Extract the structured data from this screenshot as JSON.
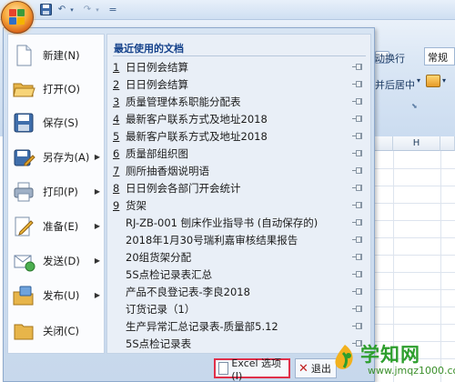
{
  "quick_access": {
    "separator": "="
  },
  "ribbon": {
    "wrap_text_label": "动换行",
    "merge_center_label": "并后居中",
    "number_format_value": "常规"
  },
  "sheet": {
    "column_h": "H"
  },
  "office_menu": {
    "commands": [
      {
        "label": "新建(N)",
        "icon": "new-document-icon",
        "submenu": false
      },
      {
        "label": "打开(O)",
        "icon": "open-folder-icon",
        "submenu": false
      },
      {
        "label": "保存(S)",
        "icon": "save-disk-icon",
        "submenu": false
      },
      {
        "label": "另存为(A)",
        "icon": "save-as-icon",
        "submenu": true
      },
      {
        "label": "打印(P)",
        "icon": "printer-icon",
        "submenu": true
      },
      {
        "label": "准备(E)",
        "icon": "prepare-icon",
        "submenu": true
      },
      {
        "label": "发送(D)",
        "icon": "send-mail-icon",
        "submenu": true
      },
      {
        "label": "发布(U)",
        "icon": "publish-icon",
        "submenu": true
      },
      {
        "label": "关闭(C)",
        "icon": "close-folder-icon",
        "submenu": false
      }
    ],
    "recent_header": "最近使用的文档",
    "recent_documents": [
      {
        "num": "1",
        "name": "日日例会结算"
      },
      {
        "num": "2",
        "name": "日日例会结算"
      },
      {
        "num": "3",
        "name": "质量管理体系职能分配表"
      },
      {
        "num": "4",
        "name": "最新客户联系方式及地址2018"
      },
      {
        "num": "5",
        "name": "最新客户联系方式及地址2018"
      },
      {
        "num": "6",
        "name": "质量部组织图"
      },
      {
        "num": "7",
        "name": "厕所抽香烟说明语"
      },
      {
        "num": "8",
        "name": "日日例会各部门开会统计"
      },
      {
        "num": "9",
        "name": "货架"
      },
      {
        "num": "",
        "name": "RJ-ZB-001 刨床作业指导书 (自动保存的)"
      },
      {
        "num": "",
        "name": "2018年1月30号瑞利嘉审核结果报告"
      },
      {
        "num": "",
        "name": "20组货架分配"
      },
      {
        "num": "",
        "name": "5S点检记录表汇总"
      },
      {
        "num": "",
        "name": "产品不良登记表-李良2018"
      },
      {
        "num": "",
        "name": "订货记录（1）"
      },
      {
        "num": "",
        "name": "生产异常汇总记录表-质量部5.12"
      },
      {
        "num": "",
        "name": "5S点检记录表"
      }
    ],
    "options_button": "Excel 选项(I)",
    "exit_button": "退出"
  },
  "watermark": {
    "text": "学知网",
    "url": "www.jmqz1000.com"
  },
  "colors": {
    "accent": "#15428b",
    "highlight_border": "#e0304a",
    "watermark_green": "#2d9e2d"
  }
}
